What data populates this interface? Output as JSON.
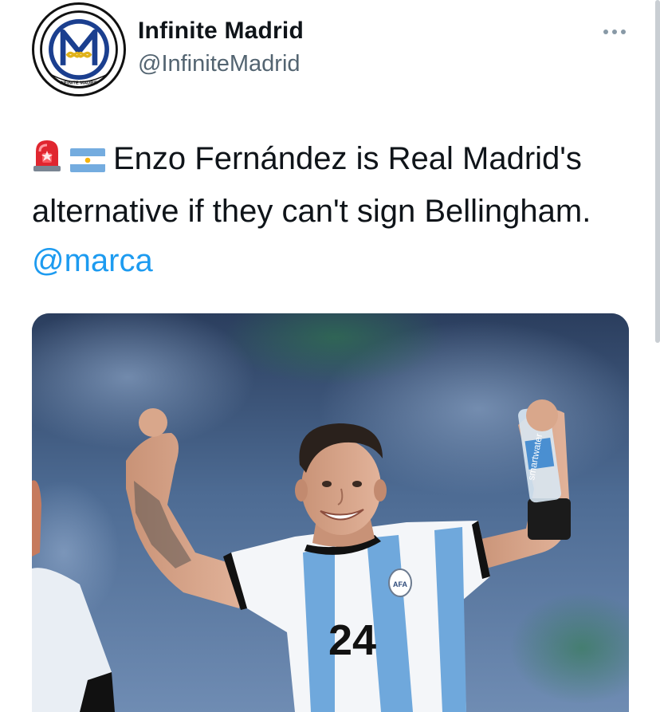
{
  "author": {
    "display_name": "Infinite Madrid",
    "handle": "@InfiniteMadrid",
    "avatar_icon": "infinite-madrid-logo-icon"
  },
  "menu": {
    "icon": "more-options-icon"
  },
  "tweet": {
    "emojis": [
      "rotating-light-emoji",
      "argentina-flag-emoji"
    ],
    "text": "Enzo Fernández is Real Madrid's alternative if they can't sign Bellingham.",
    "mention": "@marca"
  },
  "media": {
    "description_icon": "football-player-photo",
    "jersey_number": "24",
    "bottle_text": "smartwater"
  },
  "colors": {
    "text": "#0f1419",
    "secondary": "#536471",
    "link": "#1d9bf0"
  }
}
